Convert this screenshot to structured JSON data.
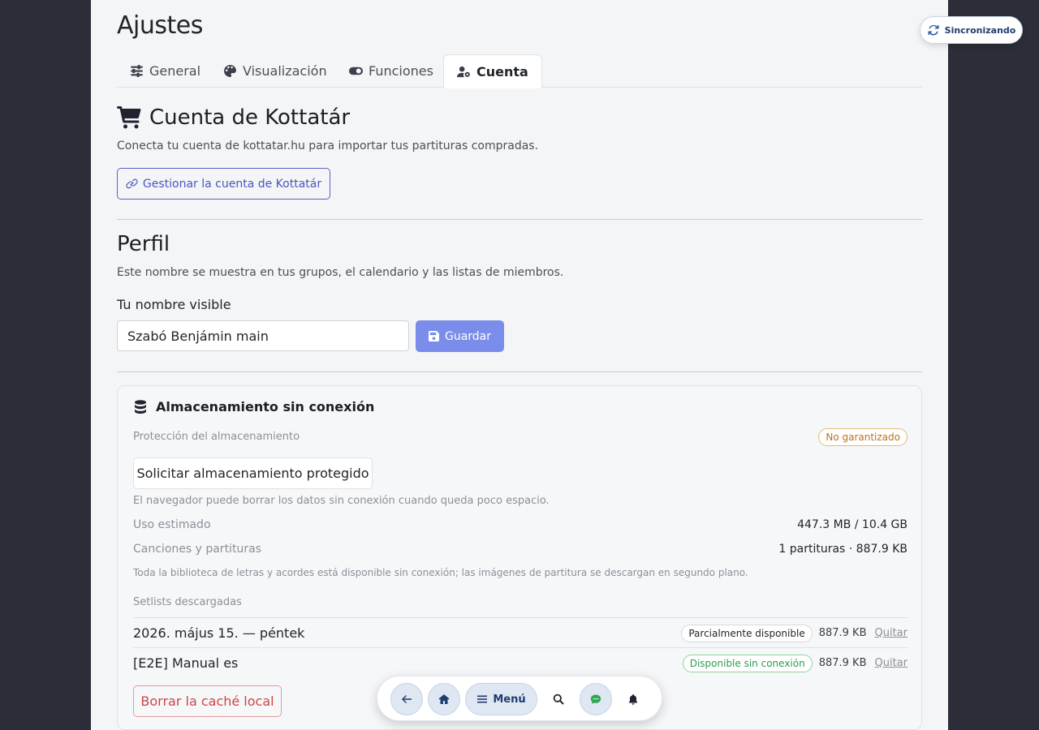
{
  "page": {
    "title": "Ajustes"
  },
  "tabs": [
    {
      "label": "General",
      "icon": "sliders-icon"
    },
    {
      "label": "Visualización",
      "icon": "palette-icon"
    },
    {
      "label": "Funciones",
      "icon": "toggle-icon"
    },
    {
      "label": "Cuenta",
      "icon": "user-gear-icon",
      "active": true
    }
  ],
  "kottatar": {
    "title": "Cuenta de Kottatár",
    "description": "Conecta tu cuenta de kottatar.hu para importar tus partituras compradas.",
    "manage_button": "Gestionar la cuenta de Kottatár"
  },
  "profile": {
    "title": "Perfil",
    "description": "Este nombre se muestra en tus grupos, el calendario y las listas de miembros.",
    "name_label": "Tu nombre visible",
    "name_value": "Szabó Benjámin main",
    "save_button": "Guardar"
  },
  "storage": {
    "title": "Almacenamiento sin conexión",
    "protection_label": "Protección del almacenamiento",
    "protection_badge": "No garantizado",
    "request_button": "Solicitar almacenamiento protegido",
    "protection_note": "El navegador puede borrar los datos sin conexión cuando queda poco espacio.",
    "usage_label": "Uso estimado",
    "usage_value": "447.3 MB / 10.4 GB",
    "songs_label": "Canciones y partituras",
    "songs_value": "1 partituras · 887.9 KB",
    "library_note": "Toda la biblioteca de letras y acordes está disponible sin conexión; las imágenes de partitura se descargan en segundo plano.",
    "setlists_label": "Setlists descargadas",
    "setlists": [
      {
        "name": "2026. május 15. — péntek",
        "status": "Parcialmente disponible",
        "size": "887.9 KB",
        "remove": "Quitar"
      },
      {
        "name": "[E2E] Manual es",
        "status": "Disponible sin conexión",
        "size": "887.9 KB",
        "remove": "Quitar"
      }
    ],
    "clear_button": "Borrar la caché local"
  },
  "sync": {
    "label": "Sincronizando"
  },
  "dock": {
    "menu_label": "Menú"
  },
  "colors": {
    "accent": "#5a63c6",
    "save": "#7b8dea",
    "warning": "#b8741a",
    "success": "#2e9b4f",
    "danger": "#d04545"
  }
}
